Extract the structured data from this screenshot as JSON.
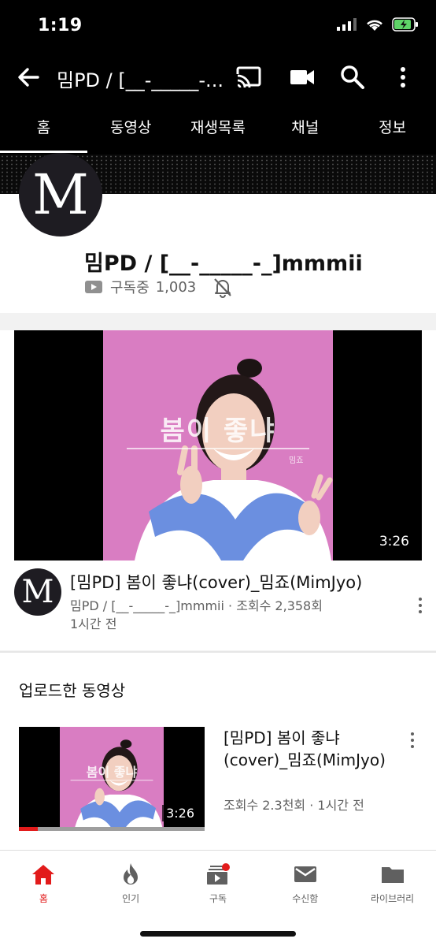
{
  "status_bar": {
    "time": "1:19"
  },
  "app_bar": {
    "title": "밈PD / [__-_____-...",
    "icons": [
      "back-arrow-icon",
      "cast-icon",
      "video-camera-icon",
      "search-icon",
      "more-vert-icon"
    ]
  },
  "tabs": [
    {
      "label": "홈",
      "active": true
    },
    {
      "label": "동영상",
      "active": false
    },
    {
      "label": "재생목록",
      "active": false
    },
    {
      "label": "채널",
      "active": false
    },
    {
      "label": "정보",
      "active": false
    }
  ],
  "channel": {
    "avatar_letter": "M",
    "name": "밈PD / [__-_____-_]mmmii",
    "subscribed_label": "구독중",
    "subscriber_count": "1,003"
  },
  "featured_video": {
    "thumbnail_text": "봄이 좋냐",
    "thumbnail_subtext": "밈죠",
    "duration": "3:26",
    "title": "[밈PD] 봄이 좋냐(cover)_밈죠(MimJyo)",
    "channel_and_views": "밈PD / [__-_____-_]mmmii · 조회수 2,358회",
    "age": "1시간 전",
    "avatar_letter": "M"
  },
  "uploads": {
    "section_title": "업로드한 동영상",
    "items": [
      {
        "title": "[밈PD] 봄이 좋냐(cover)_밈죠(MimJyo)",
        "meta": "조회수 2.3천회 · 1시간 전",
        "duration": "3:26",
        "thumbnail_text": "봄이 좋냐",
        "watched_fraction": 0.1
      }
    ]
  },
  "bottom_nav": [
    {
      "label": "홈",
      "icon": "home-icon",
      "active": true
    },
    {
      "label": "인기",
      "icon": "trending-flame-icon",
      "active": false
    },
    {
      "label": "구독",
      "icon": "subscriptions-icon",
      "active": false
    },
    {
      "label": "수신함",
      "icon": "inbox-mail-icon",
      "active": false
    },
    {
      "label": "라이브러리",
      "icon": "library-folder-icon",
      "active": false
    }
  ],
  "colors": {
    "accent": "#e21b1b",
    "header_bg": "#000000",
    "thumb_bg": "#d97dc2",
    "sweater_blue": "#6b8fe0"
  }
}
